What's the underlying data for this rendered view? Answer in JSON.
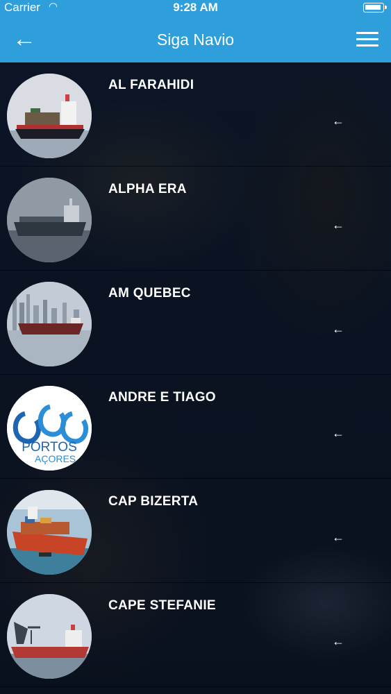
{
  "status_bar": {
    "carrier": "Carrier",
    "time": "9:28 AM"
  },
  "navbar": {
    "title": "Siga Navio",
    "back_icon": "arrow-left-icon",
    "menu_icon": "hamburger-menu-icon"
  },
  "colors": {
    "accent": "#2e9fdb"
  },
  "ships": [
    {
      "name": "AL FARAHIDI",
      "thumb": "container-ship-photo"
    },
    {
      "name": "ALPHA ERA",
      "thumb": "tanker-ship-photo"
    },
    {
      "name": "AM QUEBEC",
      "thumb": "bulk-carrier-skyline-photo"
    },
    {
      "name": "ANDRE E TIAGO",
      "thumb": "portos-dos-acores-logo",
      "logo_text": "PORTOS",
      "logo_sub": "AÇORES"
    },
    {
      "name": "CAP BIZERTA",
      "thumb": "red-container-ship-photo"
    },
    {
      "name": "CAPE STEFANIE",
      "thumb": "cargo-ship-port-cranes-photo"
    }
  ],
  "row_arrow": "←"
}
